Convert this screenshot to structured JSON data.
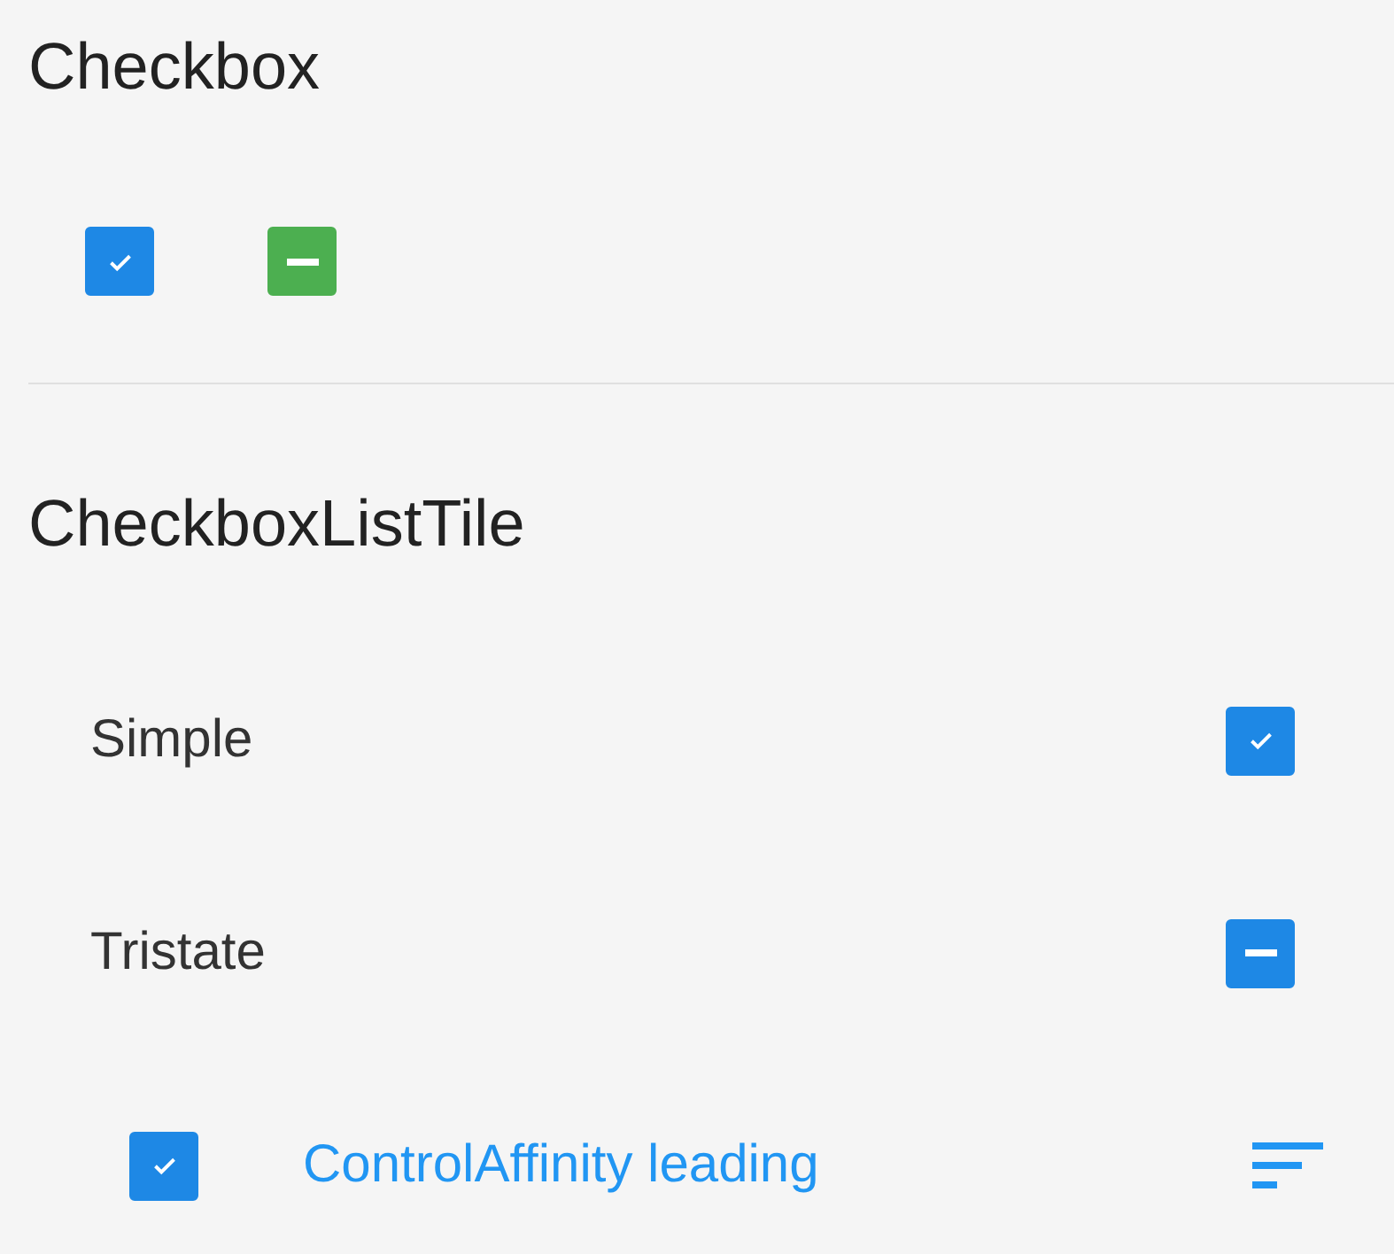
{
  "checkbox_section": {
    "title": "Checkbox",
    "checkboxes": [
      {
        "kind": "checked",
        "color": "#1e88e5"
      },
      {
        "kind": "indeterminate",
        "color": "#4caf50"
      }
    ]
  },
  "list_tile_section": {
    "title": "CheckboxListTile",
    "tiles": [
      {
        "label": "Simple",
        "kind": "checked",
        "leading": false,
        "selected": false,
        "secondary_icon": false
      },
      {
        "label": "Tristate",
        "kind": "indeterminate",
        "leading": false,
        "selected": false,
        "secondary_icon": false
      },
      {
        "label": "ControlAffinity leading",
        "kind": "checked",
        "leading": true,
        "selected": true,
        "secondary_icon": true
      }
    ]
  }
}
